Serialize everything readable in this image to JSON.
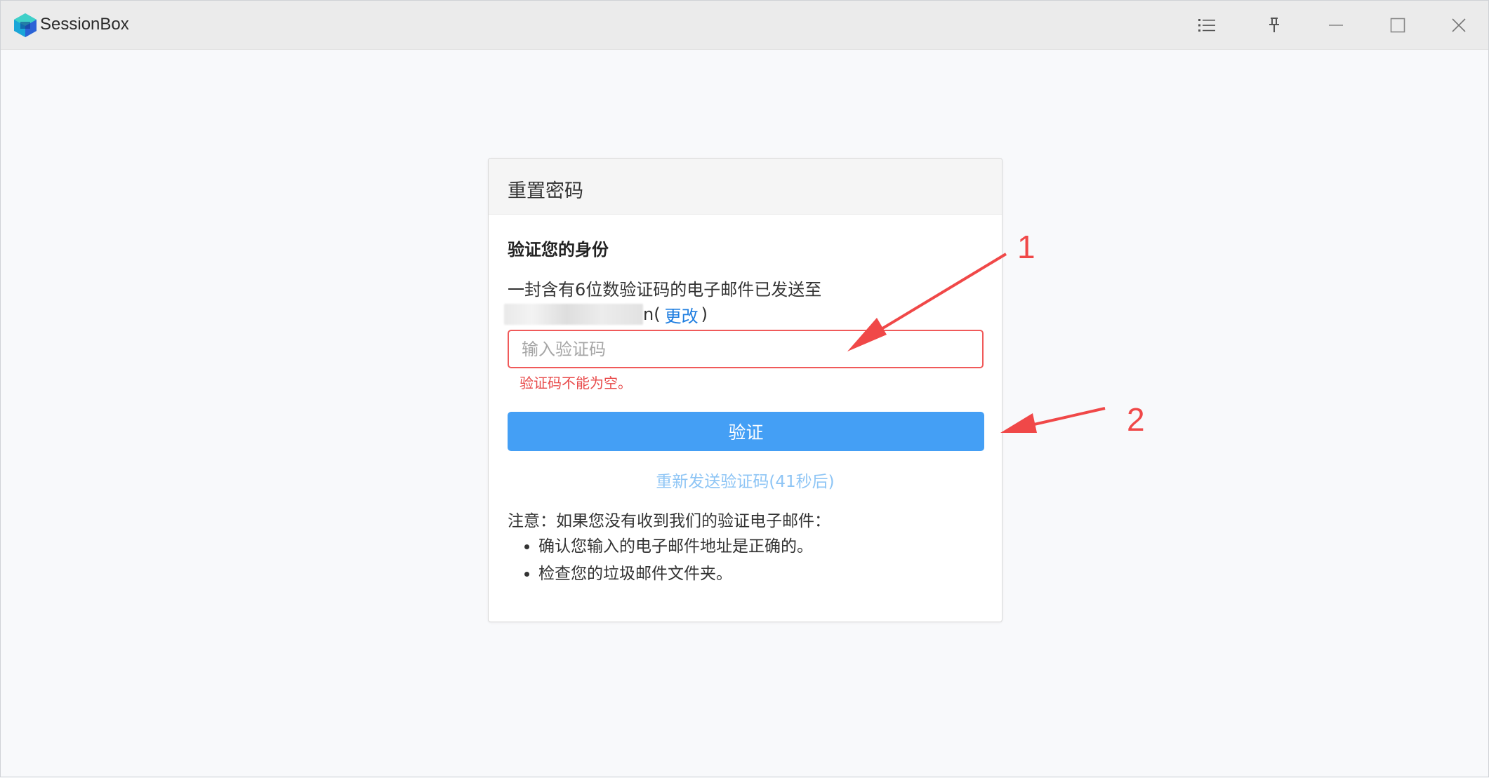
{
  "window": {
    "app_title": "SessionBox"
  },
  "card": {
    "title": "重置密码",
    "section_title": "验证您的身份",
    "info_text": "一封含有6位数验证码的电子邮件已发送至",
    "email_suffix": "n(",
    "change_label": "更改",
    "email_close": ")",
    "code_input": {
      "value": "",
      "placeholder": "输入验证码"
    },
    "error_text": "验证码不能为空。",
    "verify_label": "验证",
    "resend_label": "重新发送验证码(41秒后)",
    "note_text": "注意：如果您没有收到我们的验证电子邮件：",
    "notes": [
      "确认您输入的电子邮件地址是正确的。",
      "检查您的垃圾邮件文件夹。"
    ]
  },
  "annotations": {
    "label_1": "1",
    "label_2": "2",
    "color": "#f04848"
  },
  "colors": {
    "primary": "#449ff5",
    "link": "#1f7ee0",
    "error": "#e84a4a"
  }
}
